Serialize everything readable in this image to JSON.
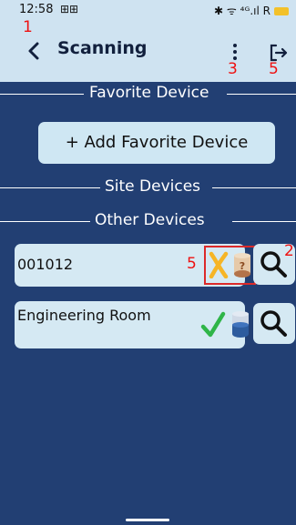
{
  "status_bar": {
    "time": "12:58",
    "apps_indicator": "⊞⊞",
    "right_icons": "✱ ᯤ ⁴ᴳ.ıl R"
  },
  "topbar": {
    "title": "Scanning",
    "back_icon": "chevron-left-icon",
    "menu_icon": "kebab-icon",
    "exit_icon": "exit-icon"
  },
  "annotations": {
    "back": "1",
    "magnify": "2",
    "menu": "3",
    "exit": "5",
    "status": "5"
  },
  "sections": {
    "favorite": "Favorite Device",
    "site": "Site Devices",
    "other": "Other Devices"
  },
  "add_favorite_button": "+ Add Favorite Device",
  "devices": [
    {
      "name": "001012",
      "status_icon": "cross-icon",
      "db_icon": "unknown-db-icon",
      "highlighted": true
    },
    {
      "name": "Engineering Room",
      "status_icon": "check-icon",
      "db_icon": "database-icon",
      "highlighted": false
    }
  ],
  "colors": {
    "background": "#223f73",
    "card": "#d5e9f3",
    "header": "#cfe3f1",
    "annotation": "#e11111",
    "check": "#2fb548",
    "cross": "#f6b526"
  }
}
